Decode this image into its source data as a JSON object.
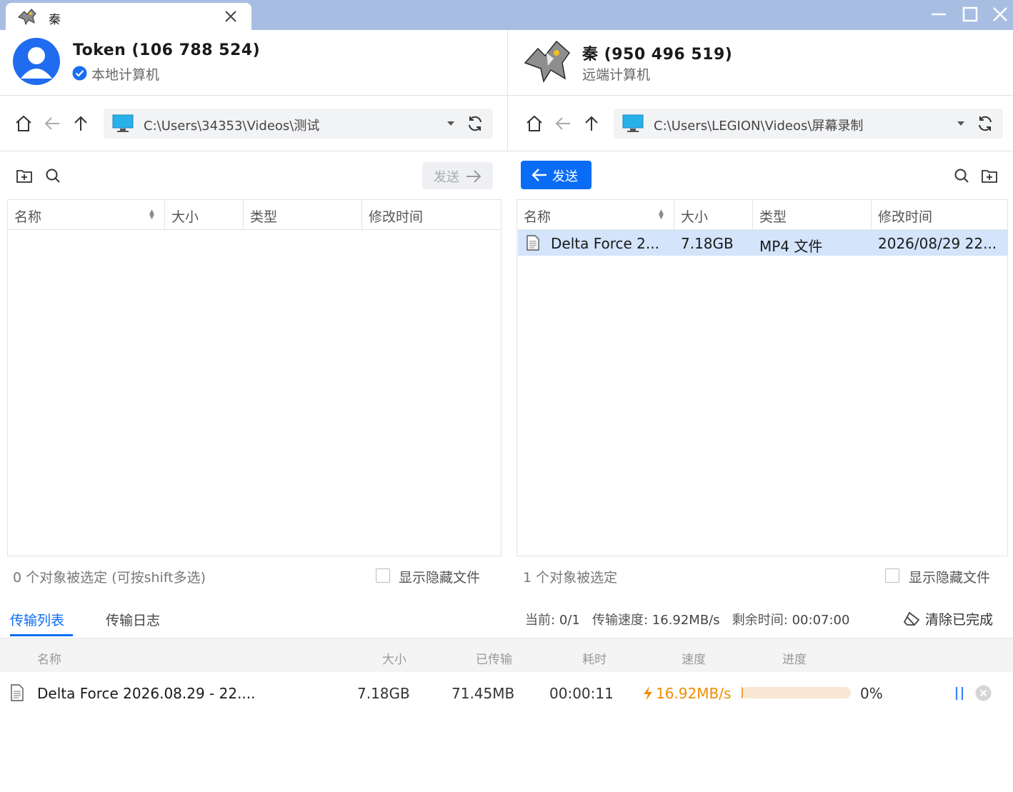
{
  "window": {
    "tab_title": "秦"
  },
  "local": {
    "name": "Token (106 788 524)",
    "sub": "本地计算机",
    "path": "C:\\Users\\34353\\Videos\\测试",
    "send_label": "发送",
    "columns": [
      "名称",
      "大小",
      "类型",
      "修改时间"
    ],
    "status": "0 个对象被选定 (可按shift多选)",
    "show_hidden": "显示隐藏文件"
  },
  "remote": {
    "name": "秦 (950 496 519)",
    "sub": "远端计算机",
    "path": "C:\\Users\\LEGION\\Videos\\屏幕录制",
    "send_label": "发送",
    "columns": [
      "名称",
      "大小",
      "类型",
      "修改时间"
    ],
    "files": [
      {
        "name": "Delta Force 2...",
        "size": "7.18GB",
        "type": "MP4 文件",
        "modified": "2026/08/29 22..."
      }
    ],
    "status": "1 个对象被选定",
    "show_hidden": "显示隐藏文件"
  },
  "transfer": {
    "tabs": [
      "传输列表",
      "传输日志"
    ],
    "current_label": "当前:",
    "current_value": "0/1",
    "speed_label": "传输速度:",
    "speed_value": "16.92MB/s",
    "remaining_label": "剩余时间:",
    "remaining_value": "00:07:00",
    "clear_label": "清除已完成",
    "columns": [
      "名称",
      "大小",
      "已传输",
      "耗时",
      "速度",
      "进度"
    ],
    "rows": [
      {
        "name": "Delta Force 2026.08.29 - 22....",
        "size": "7.18GB",
        "transferred": "71.45MB",
        "elapsed": "00:00:11",
        "speed": "16.92MB/s",
        "progress_fraction": 0.01,
        "progress_text": "0%"
      }
    ]
  },
  "colors": {
    "accent": "#0a6cf5",
    "titlebar": "#a8bde2",
    "selected_row": "#d3e4fb",
    "speed": "#f08c00",
    "progress_track": "#f7e7d3"
  }
}
